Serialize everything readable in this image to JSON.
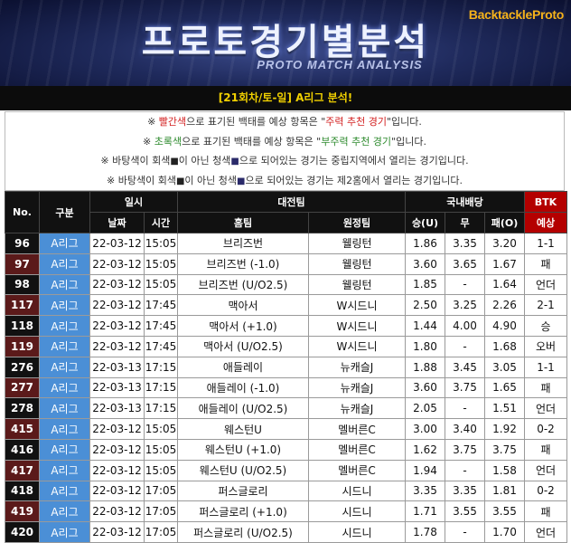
{
  "banner": {
    "title": "프로토경기별분석",
    "subtitle": "PROTO MATCH ANALYSIS",
    "logo": "BacktackleProto"
  },
  "round_label": "[21회차/토-일] A리그 분석!",
  "notices": [
    {
      "pre": "※ ",
      "hl": "빨간색",
      "hl_color": "#d32020",
      "mid": "으로 표기된 백태를 예상 항목은 \"",
      "q": "주력 추천 경기",
      "post": "\"입니다."
    },
    {
      "pre": "※ ",
      "hl": "초록색",
      "hl_color": "#2e8b2e",
      "mid": "으로 표기된 백태를 예상 항목은 \"",
      "q": "부주력 추천 경기",
      "post": "\"입니다."
    },
    {
      "a": "※ 바탕색이 회색",
      "sq": "■",
      "b": "이 아닌 청색",
      "sq2": "■",
      "c": "으로 되어있는 경기는 중립지역에서 열리는 경기입니다."
    },
    {
      "a": "※ 바탕색이 회색",
      "sq": "■",
      "b": "이 아닌 청색",
      "sq2": "■",
      "c": "으로 되어있는 경기는 제2홈에서 열리는 경기입니다."
    }
  ],
  "headers": {
    "no": "No.",
    "category": "구분",
    "datetime": "일시",
    "date": "날짜",
    "time": "시간",
    "match": "대전팀",
    "home": "홈팀",
    "away": "원정팀",
    "odds": "국내배당",
    "win": "승(U)",
    "draw": "무",
    "lose": "패(O)",
    "btk_line1": "BTK",
    "btk_line2": "예상"
  },
  "colors": {
    "result_black": "#111111",
    "result_red": "#d40000",
    "result_green": "#1a9a1a",
    "league_bg": "#4b8fd6"
  },
  "rows": [
    {
      "no": "96",
      "league": "A리그",
      "date": "22-03-12",
      "time": "15:05",
      "home": "브리즈번",
      "away": "웰링턴",
      "win": "1.86",
      "draw": "3.35",
      "lose": "3.20",
      "pick": "1-1",
      "pick_color": "black"
    },
    {
      "no": "97",
      "league": "A리그",
      "date": "22-03-12",
      "time": "15:05",
      "home": "브리즈번 (-1.0)",
      "away": "웰링턴",
      "win": "3.60",
      "draw": "3.65",
      "lose": "1.67",
      "pick": "패",
      "pick_color": "red"
    },
    {
      "no": "98",
      "league": "A리그",
      "date": "22-03-12",
      "time": "15:05",
      "home": "브리즈번 (U/O2.5)",
      "away": "웰링턴",
      "win": "1.85",
      "draw": "-",
      "lose": "1.64",
      "pick": "언더",
      "pick_color": "black"
    },
    {
      "no": "117",
      "league": "A리그",
      "date": "22-03-12",
      "time": "17:45",
      "home": "맥아서",
      "away": "W시드니",
      "win": "2.50",
      "draw": "3.25",
      "lose": "2.26",
      "pick": "2-1",
      "pick_color": "black"
    },
    {
      "no": "118",
      "league": "A리그",
      "date": "22-03-12",
      "time": "17:45",
      "home": "맥아서 (+1.0)",
      "away": "W시드니",
      "win": "1.44",
      "draw": "4.00",
      "lose": "4.90",
      "pick": "승",
      "pick_color": "green"
    },
    {
      "no": "119",
      "league": "A리그",
      "date": "22-03-12",
      "time": "17:45",
      "home": "맥아서 (U/O2.5)",
      "away": "W시드니",
      "win": "1.80",
      "draw": "-",
      "lose": "1.68",
      "pick": "오버",
      "pick_color": "black"
    },
    {
      "no": "276",
      "league": "A리그",
      "date": "22-03-13",
      "time": "17:15",
      "home": "애들레이",
      "away": "뉴캐슬J",
      "win": "1.88",
      "draw": "3.45",
      "lose": "3.05",
      "pick": "1-1",
      "pick_color": "black"
    },
    {
      "no": "277",
      "league": "A리그",
      "date": "22-03-13",
      "time": "17:15",
      "home": "애들레이 (-1.0)",
      "away": "뉴캐슬J",
      "win": "3.60",
      "draw": "3.75",
      "lose": "1.65",
      "pick": "패",
      "pick_color": "black"
    },
    {
      "no": "278",
      "league": "A리그",
      "date": "22-03-13",
      "time": "17:15",
      "home": "애들레이 (U/O2.5)",
      "away": "뉴캐슬J",
      "win": "2.05",
      "draw": "-",
      "lose": "1.51",
      "pick": "언더",
      "pick_color": "black"
    },
    {
      "no": "415",
      "league": "A리그",
      "date": "22-03-12",
      "time": "15:05",
      "home": "웨스턴U",
      "away": "멜버른C",
      "win": "3.00",
      "draw": "3.40",
      "lose": "1.92",
      "pick": "0-2",
      "pick_color": "green"
    },
    {
      "no": "416",
      "league": "A리그",
      "date": "22-03-12",
      "time": "15:05",
      "home": "웨스턴U (+1.0)",
      "away": "멜버른C",
      "win": "1.62",
      "draw": "3.75",
      "lose": "3.75",
      "pick": "패",
      "pick_color": "black"
    },
    {
      "no": "417",
      "league": "A리그",
      "date": "22-03-12",
      "time": "15:05",
      "home": "웨스턴U (U/O2.5)",
      "away": "멜버른C",
      "win": "1.94",
      "draw": "-",
      "lose": "1.58",
      "pick": "언더",
      "pick_color": "black"
    },
    {
      "no": "418",
      "league": "A리그",
      "date": "22-03-12",
      "time": "17:05",
      "home": "퍼스글로리",
      "away": "시드니",
      "win": "3.35",
      "draw": "3.35",
      "lose": "1.81",
      "pick": "0-2",
      "pick_color": "red"
    },
    {
      "no": "419",
      "league": "A리그",
      "date": "22-03-12",
      "time": "17:05",
      "home": "퍼스글로리 (+1.0)",
      "away": "시드니",
      "win": "1.71",
      "draw": "3.55",
      "lose": "3.55",
      "pick": "패",
      "pick_color": "black"
    },
    {
      "no": "420",
      "league": "A리그",
      "date": "22-03-12",
      "time": "17:05",
      "home": "퍼스글로리 (U/O2.5)",
      "away": "시드니",
      "win": "1.78",
      "draw": "-",
      "lose": "1.70",
      "pick": "언더",
      "pick_color": "black"
    }
  ]
}
